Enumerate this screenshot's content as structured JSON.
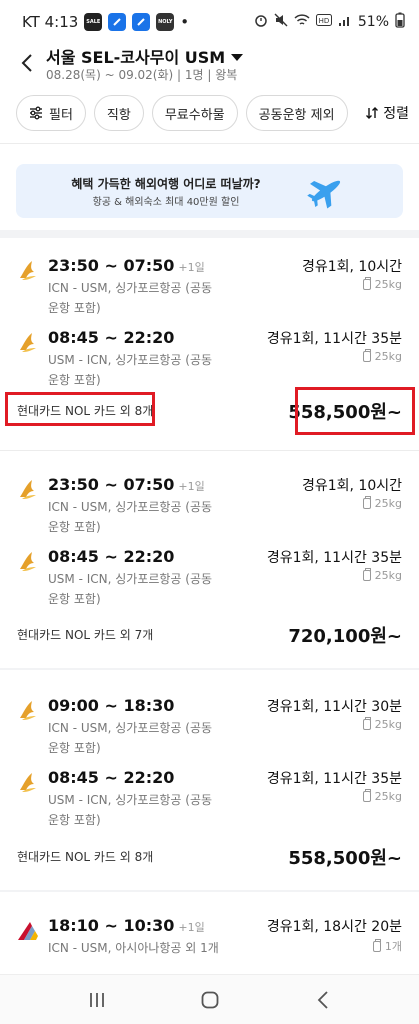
{
  "status_bar": {
    "carrier_time": "KT 4:13",
    "dot": "•",
    "battery": "51%",
    "mini_badges": [
      "SALE",
      "",
      "",
      "NOLY"
    ]
  },
  "header": {
    "route_title": "서울 SEL-코사무이 USM",
    "subtitle": "08.28(목) ~ 09.02(화) | 1명 | 왕복"
  },
  "filters": {
    "chips": [
      "필터",
      "직항",
      "무료수하물",
      "공동운항 제외"
    ],
    "sort_label": "정렬"
  },
  "banner": {
    "title": "혜택 가득한 해외여행 어디로 떠날까?",
    "subtitle": "항공 & 해외숙소 최대 40만원 할인"
  },
  "results": [
    {
      "segments": [
        {
          "time": "23:50 ~ 07:50",
          "plus_day": "+1일",
          "route": "ICN - USM, 싱가포르항공 (공동운항 포함)",
          "stops": "경유1회, 10시간",
          "baggage": "25kg"
        },
        {
          "time": "08:45 ~ 22:20",
          "plus_day": "",
          "route": "USM - ICN, 싱가포르항공 (공동운항 포함)",
          "stops": "경유1회, 11시간 35분",
          "baggage": "25kg"
        }
      ],
      "card_discount": "현대카드 NOL 카드 외 8개",
      "price": "558,500원~"
    },
    {
      "segments": [
        {
          "time": "23:50 ~ 07:50",
          "plus_day": "+1일",
          "route": "ICN - USM, 싱가포르항공 (공동운항 포함)",
          "stops": "경유1회, 10시간",
          "baggage": "25kg"
        },
        {
          "time": "08:45 ~ 22:20",
          "plus_day": "",
          "route": "USM - ICN, 싱가포르항공 (공동운항 포함)",
          "stops": "경유1회, 11시간 35분",
          "baggage": "25kg"
        }
      ],
      "card_discount": "현대카드 NOL 카드 외 7개",
      "price": "720,100원~"
    },
    {
      "segments": [
        {
          "time": "09:00 ~ 18:30",
          "plus_day": "",
          "route": "ICN - USM, 싱가포르항공 (공동운항 포함)",
          "stops": "경유1회, 11시간 30분",
          "baggage": "25kg"
        },
        {
          "time": "08:45 ~ 22:20",
          "plus_day": "",
          "route": "USM - ICN, 싱가포르항공 (공동운항 포함)",
          "stops": "경유1회, 11시간 35분",
          "baggage": "25kg"
        }
      ],
      "card_discount": "현대카드 NOL 카드 외 8개",
      "price": "558,500원~"
    },
    {
      "segments": [
        {
          "time": "18:10 ~ 10:30",
          "plus_day": "+1일",
          "route": "ICN - USM, 아시아나항공 외 1개",
          "stops": "경유1회, 18시간 20분",
          "baggage": "1개"
        }
      ]
    }
  ],
  "colors": {
    "singapore_gold": "#e5a02a",
    "asiana_red": "#c8102e",
    "highlight_red": "#e01b24",
    "banner_bg": "#eaf2fd",
    "plane_blue": "#3aa0ee"
  }
}
